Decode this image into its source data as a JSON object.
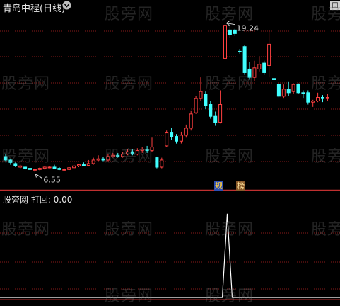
{
  "header": {
    "title": "青岛中程(日线)"
  },
  "indicator": {
    "label": "股旁网  打回: 0.00"
  },
  "window": {
    "restore_glyph": "□"
  },
  "annotations": {
    "high": "19.24",
    "low": "6.55"
  },
  "badges": [
    {
      "label": "规"
    },
    {
      "label": "榜"
    }
  ],
  "watermark": {
    "text": "股旁网"
  },
  "colors": {
    "up": "#ff4040",
    "down": "#40ffff",
    "signal": "#ffffff",
    "grid": "#8a1a1a",
    "divider": "#c03030"
  },
  "chart_data": [
    {
      "type": "candlestick",
      "title": "青岛中程(日线)",
      "ylim": [
        5.2,
        20.3
      ],
      "annotations": [
        {
          "label": "19.24",
          "value": 19.24
        },
        {
          "label": "6.55",
          "value": 6.55
        }
      ],
      "candles": [
        {
          "o": 7.9,
          "c": 7.6,
          "h": 8.1,
          "l": 7.5
        },
        {
          "o": 7.6,
          "c": 7.4,
          "h": 7.7,
          "l": 7.2
        },
        {
          "o": 7.3,
          "c": 7.1,
          "h": 7.4,
          "l": 7.0
        },
        {
          "o": 7.0,
          "c": 7.1,
          "h": 7.2,
          "l": 6.9
        },
        {
          "o": 7.0,
          "c": 6.9,
          "h": 7.1,
          "l": 6.8
        },
        {
          "o": 6.9,
          "c": 6.8,
          "h": 7.0,
          "l": 6.7
        },
        {
          "o": 6.8,
          "c": 6.8,
          "h": 6.9,
          "l": 6.55
        },
        {
          "o": 6.8,
          "c": 6.9,
          "h": 7.0,
          "l": 6.7
        },
        {
          "o": 6.9,
          "c": 7.0,
          "h": 7.1,
          "l": 6.8
        },
        {
          "o": 7.0,
          "c": 7.0,
          "h": 7.1,
          "l": 6.9
        },
        {
          "o": 7.0,
          "c": 6.9,
          "h": 7.2,
          "l": 6.85
        },
        {
          "o": 6.9,
          "c": 6.8,
          "h": 7.0,
          "l": 6.75
        },
        {
          "o": 6.8,
          "c": 6.8,
          "h": 6.9,
          "l": 6.7
        },
        {
          "o": 6.8,
          "c": 6.95,
          "h": 7.0,
          "l": 6.75
        },
        {
          "o": 6.95,
          "c": 7.1,
          "h": 7.2,
          "l": 6.9
        },
        {
          "o": 7.1,
          "c": 7.2,
          "h": 7.3,
          "l": 7.0
        },
        {
          "o": 7.2,
          "c": 7.15,
          "h": 7.4,
          "l": 7.1
        },
        {
          "o": 7.15,
          "c": 7.3,
          "h": 7.6,
          "l": 7.1
        },
        {
          "o": 7.3,
          "c": 7.6,
          "h": 7.8,
          "l": 7.2
        },
        {
          "o": 7.6,
          "c": 7.7,
          "h": 8.0,
          "l": 7.5
        },
        {
          "o": 7.7,
          "c": 7.6,
          "h": 7.9,
          "l": 7.5
        },
        {
          "o": 7.6,
          "c": 7.9,
          "h": 8.1,
          "l": 7.5
        },
        {
          "o": 7.9,
          "c": 8.0,
          "h": 8.2,
          "l": 7.8
        },
        {
          "o": 8.0,
          "c": 7.9,
          "h": 8.2,
          "l": 7.8
        },
        {
          "o": 7.9,
          "c": 8.1,
          "h": 8.3,
          "l": 7.8
        },
        {
          "o": 8.1,
          "c": 8.3,
          "h": 8.5,
          "l": 8.0
        },
        {
          "o": 8.3,
          "c": 8.1,
          "h": 8.5,
          "l": 8.0
        },
        {
          "o": 8.1,
          "c": 8.4,
          "h": 8.6,
          "l": 8.0
        },
        {
          "o": 8.4,
          "c": 8.5,
          "h": 8.7,
          "l": 8.2
        },
        {
          "o": 8.5,
          "c": 8.4,
          "h": 8.8,
          "l": 8.2
        },
        {
          "o": 8.4,
          "c": 8.7,
          "h": 9.5,
          "l": 8.3
        },
        {
          "o": 7.8,
          "c": 7.0,
          "h": 7.9,
          "l": 6.9
        },
        {
          "o": 7.0,
          "c": 7.6,
          "h": 7.8,
          "l": 6.9
        },
        {
          "o": 8.8,
          "c": 9.9,
          "h": 10.1,
          "l": 8.7
        },
        {
          "o": 9.9,
          "c": 9.6,
          "h": 10.3,
          "l": 9.3
        },
        {
          "o": 9.6,
          "c": 9.2,
          "h": 9.8,
          "l": 9.0
        },
        {
          "o": 9.2,
          "c": 9.7,
          "h": 10.0,
          "l": 9.0
        },
        {
          "o": 9.7,
          "c": 10.3,
          "h": 10.6,
          "l": 9.5
        },
        {
          "o": 10.3,
          "c": 11.5,
          "h": 11.8,
          "l": 10.1
        },
        {
          "o": 11.6,
          "c": 12.8,
          "h": 13.0,
          "l": 11.5
        },
        {
          "o": 12.8,
          "c": 13.4,
          "h": 14.6,
          "l": 12.6
        },
        {
          "o": 13.2,
          "c": 12.2,
          "h": 13.4,
          "l": 11.9
        },
        {
          "o": 12.3,
          "c": 11.3,
          "h": 12.6,
          "l": 11.1
        },
        {
          "o": 11.3,
          "c": 10.8,
          "h": 11.7,
          "l": 10.5
        },
        {
          "o": 10.8,
          "c": 12.3,
          "h": 13.5,
          "l": 10.7
        },
        {
          "o": 16.2,
          "c": 19.0,
          "h": 19.24,
          "l": 16.0
        },
        {
          "o": 18.6,
          "c": 18.2,
          "h": 19.1,
          "l": 17.9
        },
        {
          "o": 18.6,
          "c": 18.3,
          "h": 18.7,
          "l": 18.1
        },
        {
          "o": 16.8,
          "c": 16.75,
          "h": 17.0,
          "l": 16.6
        },
        {
          "o": 17.2,
          "c": 15.0,
          "h": 17.3,
          "l": 14.8
        },
        {
          "o": 15.3,
          "c": 14.6,
          "h": 15.9,
          "l": 14.4
        },
        {
          "o": 14.6,
          "c": 15.4,
          "h": 16.0,
          "l": 14.3
        },
        {
          "o": 15.3,
          "c": 15.7,
          "h": 16.4,
          "l": 15.1
        },
        {
          "o": 15.8,
          "c": 15.0,
          "h": 16.0,
          "l": 14.8
        },
        {
          "o": 15.6,
          "c": 17.4,
          "h": 18.6,
          "l": 14.6
        },
        {
          "o": 14.5,
          "c": 14.4,
          "h": 14.7,
          "l": 14.1
        },
        {
          "o": 14.0,
          "c": 13.0,
          "h": 14.1,
          "l": 12.9
        },
        {
          "o": 13.0,
          "c": 13.6,
          "h": 14.0,
          "l": 12.8
        },
        {
          "o": 13.6,
          "c": 13.3,
          "h": 14.2,
          "l": 13.0
        },
        {
          "o": 13.4,
          "c": 14.0,
          "h": 14.1,
          "l": 13.2
        },
        {
          "o": 14.0,
          "c": 13.3,
          "h": 14.1,
          "l": 13.2
        },
        {
          "o": 13.3,
          "c": 13.2,
          "h": 13.5,
          "l": 12.8
        },
        {
          "o": 13.3,
          "c": 12.5,
          "h": 13.5,
          "l": 12.3
        },
        {
          "o": 12.5,
          "c": 12.6,
          "h": 12.7,
          "l": 12.1
        },
        {
          "o": 12.6,
          "c": 12.9,
          "h": 13.3,
          "l": 12.5
        },
        {
          "o": 12.9,
          "c": 12.8,
          "h": 13.1,
          "l": 12.5
        },
        {
          "o": 12.8,
          "c": 12.9,
          "h": 13.2,
          "l": 12.6
        }
      ]
    },
    {
      "type": "line",
      "title": "打回",
      "ylim": [
        0,
        1.1
      ],
      "spike_index": 45,
      "spike_value": 1.0,
      "length": 66
    }
  ]
}
